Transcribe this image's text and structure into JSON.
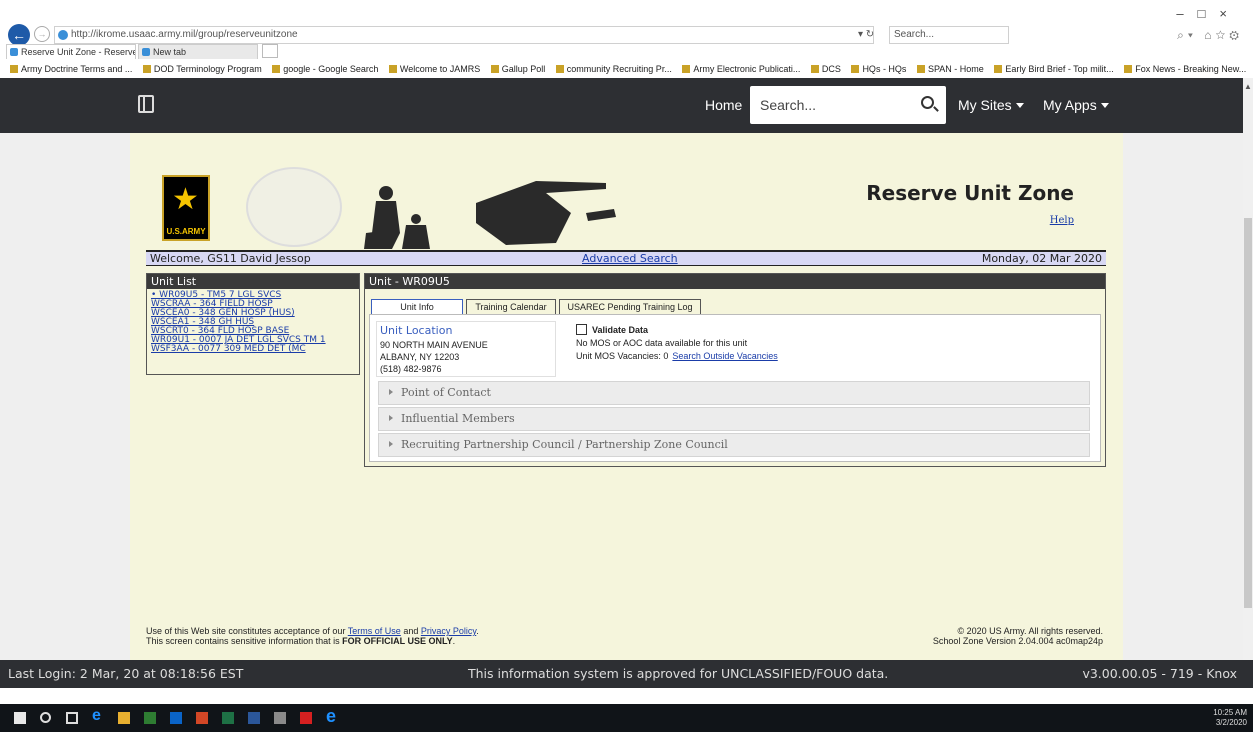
{
  "browser": {
    "url": "http://ikrome.usaac.army.mil/group/reserveunitzone",
    "search_placeholder": "Search...",
    "tabs": [
      {
        "label": "Reserve Unit Zone - Reserve... ×"
      },
      {
        "label": "New tab"
      }
    ],
    "favorites": [
      "Army Doctrine Terms and ...",
      "DOD Terminology Program",
      "google - Google Search",
      "Welcome to JAMRS",
      "Gallup Poll",
      "community Recruiting Pr...",
      "Army Electronic Publicati...",
      "DCS",
      "HQs - HQs",
      "SPAN - Home",
      "Early Bird Brief - Top milit...",
      "Fox News - Breaking New..."
    ]
  },
  "nav": {
    "home": "Home",
    "search_placeholder": "Search...",
    "my_sites": "My Sites",
    "my_apps": "My Apps"
  },
  "banner": {
    "logo_text": "U.S.ARMY",
    "title": "Reserve Unit Zone",
    "help": "Help"
  },
  "welcome_bar": {
    "welcome": "Welcome, GS11 David Jessop",
    "advanced_search": "Advanced Search",
    "date": "Monday, 02 Mar 2020"
  },
  "unit_list": {
    "title": "Unit List",
    "items": [
      "• WR09U5 - TM5 7 LGL SVCS",
      "WSCRAA - 364 FIELD HOSP",
      "WSCEA0 - 348 GEN HOSP (HUS)",
      "WSCEA1 - 348 GH HUS",
      "WSCRT0 - 364 FLD HOSP BASE",
      "WR09U1 - 0007 JA DET LGL SVCS TM 1",
      "WSF3AA - 0077 309 MED DET (MC"
    ]
  },
  "unit_panel": {
    "title": "Unit - WR09U5",
    "tabs": [
      "Unit Info",
      "Training Calendar",
      "USAREC Pending Training Log"
    ],
    "location": {
      "title": "Unit Location",
      "line1": "90 NORTH MAIN AVENUE",
      "line2": "ALBANY, NY 12203",
      "line3": "(518) 482-9876"
    },
    "validate_label": "Validate Data",
    "mos_text": "No MOS or AOC data available for this unit",
    "mos_vacancies": "Unit MOS Vacancies: 0",
    "search_outside": "Search Outside Vacancies",
    "sections": [
      "Point of Contact",
      "Influential Members",
      "Recruiting Partnership Council / Partnership Zone Council"
    ]
  },
  "footer": {
    "line1_prefix": "Use of this Web site constitutes acceptance of our",
    "terms": "Terms of Use",
    "and": "and",
    "privacy": "Privacy Policy",
    "line2_prefix": "This screen contains sensitive information that is",
    "line2_bold": "FOR OFFICIAL USE ONLY",
    "copyright": "© 2020 US Army. All rights reserved.",
    "version": "School Zone Version 2.04.004 ac0map24p"
  },
  "status_bar": {
    "last_login": "Last Login: 2 Mar, 20 at 08:18:56 EST",
    "approved": "This information system is approved for UNCLASSIFIED/FOUO data.",
    "version": "v3.00.00.05 - 719 - Knox"
  },
  "taskbar": {
    "time": "10:25 AM",
    "date": "3/2/2020"
  }
}
